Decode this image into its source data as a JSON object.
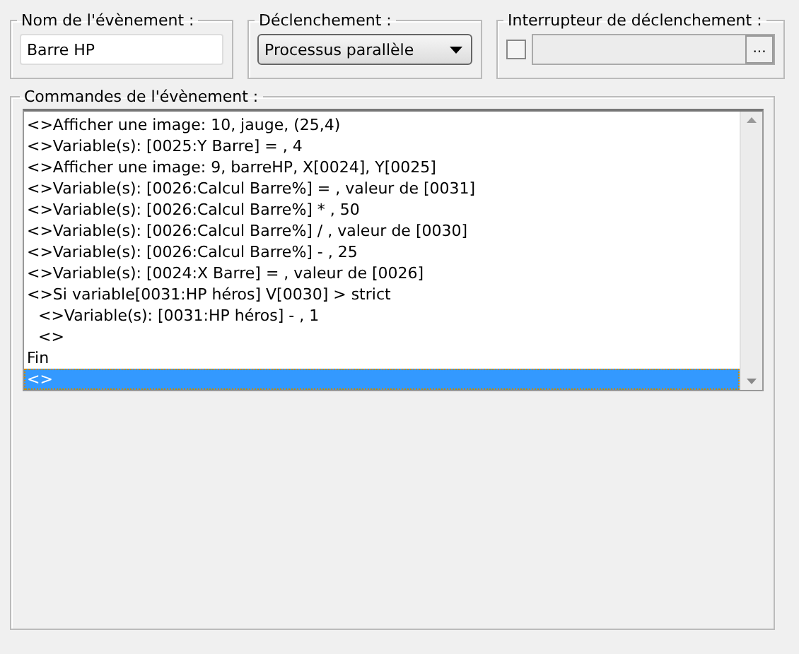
{
  "event_name": {
    "label": "Nom de l'évènement :",
    "value": "Barre HP"
  },
  "trigger": {
    "label": "Déclenchement :",
    "value": "Processus parallèle"
  },
  "switch": {
    "label": "Interrupteur de déclenchement :",
    "checked": false,
    "button": "..."
  },
  "commands": {
    "label": "Commandes de l'évènement :",
    "lines": [
      {
        "text": "<>Afficher une image: 10, jauge, (25,4)",
        "selected": false
      },
      {
        "text": "<>Variable(s): [0025:Y Barre]  = , 4",
        "selected": false
      },
      {
        "text": "<>Afficher une image: 9, barreHP, X[0024], Y[0025]",
        "selected": false
      },
      {
        "text": "<>Variable(s): [0026:Calcul Barre%]  = , valeur de [0031]",
        "selected": false
      },
      {
        "text": "<>Variable(s): [0026:Calcul Barre%]  * , 50",
        "selected": false
      },
      {
        "text": "<>Variable(s): [0026:Calcul Barre%]  / , valeur de [0030]",
        "selected": false
      },
      {
        "text": "<>Variable(s): [0026:Calcul Barre%]  - , 25",
        "selected": false
      },
      {
        "text": "<>Variable(s): [0024:X Barre]  = , valeur de [0026]",
        "selected": false
      },
      {
        "text": "<>Si variable[0031:HP héros] V[0030] > strict",
        "selected": false,
        "children": [
          {
            "text": "<>Variable(s): [0031:HP héros]  - , 1",
            "selected": false
          },
          {
            "text": "<>",
            "selected": false
          }
        ]
      },
      {
        "text": "Fin",
        "selected": false
      },
      {
        "text": "<>",
        "selected": true
      }
    ]
  }
}
